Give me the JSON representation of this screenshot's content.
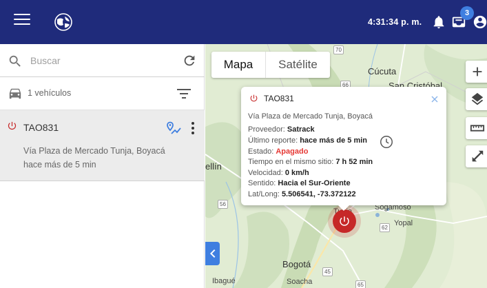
{
  "header": {
    "time": "4:31:34 p. m.",
    "notifications_count": "3",
    "menu_icon": "menu-icon",
    "logo_icon": "globe-logo-icon",
    "bell_icon": "bell-icon",
    "inbox_icon": "inbox-icon",
    "account_icon": "account-circle-icon"
  },
  "sidebar": {
    "search": {
      "placeholder": "Buscar",
      "value": ""
    },
    "vehicles_count_label": "1 vehículos",
    "vehicles": [
      {
        "plate": "TAO831",
        "address": "Vía Plaza de Mercado Tunja, Boyacá",
        "last_seen": "hace más de 5 min",
        "status_color": "#c62828"
      }
    ]
  },
  "map": {
    "type_tabs": [
      "Mapa",
      "Satélite"
    ],
    "selected_type": "Mapa",
    "labels": {
      "cucuta": "Cúcuta",
      "san_cristobal": "San Cristóbal",
      "medellin": "ellín",
      "tunja": "Tunja",
      "sogamoso": "Sogamoso",
      "yopal": "Yopal",
      "bogota": "Bogotá",
      "ibague": "Ibagué",
      "soacha": "Soacha"
    },
    "road_shields": [
      "70",
      "66",
      "56",
      "62",
      "65",
      "45"
    ],
    "popup": {
      "plate": "TAO831",
      "address": "Vía Plaza de Mercado Tunja, Boyacá",
      "provider_label": "Proveedor:",
      "provider": "Satrack",
      "last_report_label": "Último reporte:",
      "last_report": "hace más de 5 min",
      "state_label": "Estado:",
      "state": "Apagado",
      "same_place_label": "Tiempo en el mismo sitio:",
      "same_place": "7 h 52 min",
      "speed_label": "Velocidad:",
      "speed": "0 km/h",
      "direction_label": "Sentido:",
      "direction": "Hacia el Sur-Oriente",
      "latlong_label": "Lat/Long:",
      "latlong": "5.506541, -73.372122"
    }
  },
  "colors": {
    "header_bg": "#1f2b7b",
    "accent_blue": "#3f7fe0",
    "off_red": "#e53935",
    "marker_red": "#c62828"
  }
}
